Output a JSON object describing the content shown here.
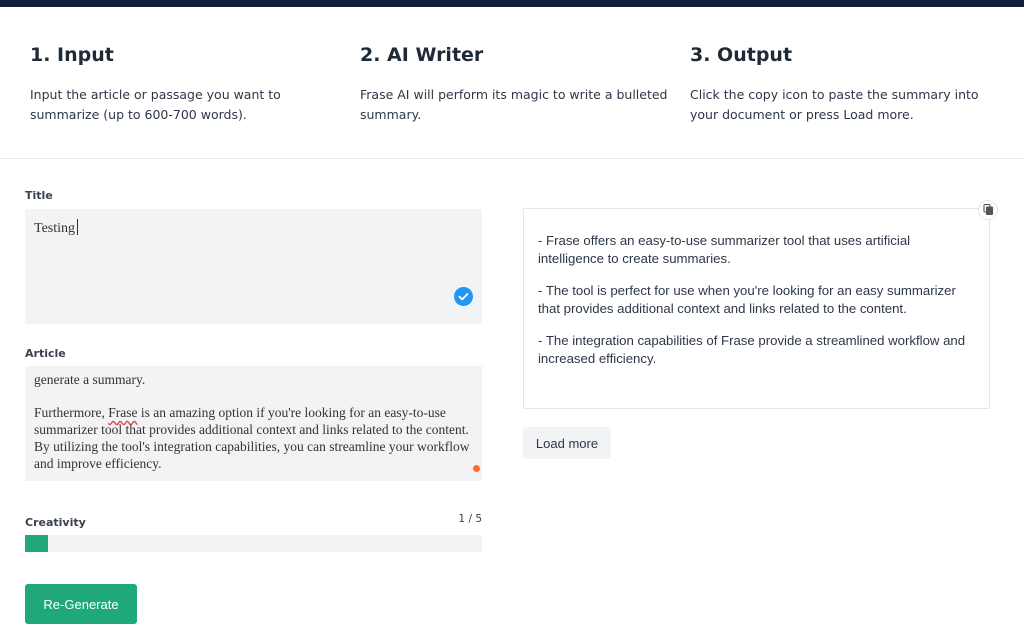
{
  "steps": [
    {
      "title": "1. Input",
      "description": "Input the article or passage you want to summarize (up to 600-700 words)."
    },
    {
      "title": "2. AI Writer",
      "description": "Frase AI will perform its magic to write a bulleted summary."
    },
    {
      "title": "3. Output",
      "description": "Click the copy icon to paste the summary into your document or press Load more."
    }
  ],
  "form": {
    "title_label": "Title",
    "title_value": "Testing",
    "article_label": "Article",
    "article_paragraphs": {
      "p1": "generate a summary.",
      "p2_before": "Furthermore, ",
      "p2_flagged_word": "Frase",
      "p2_after": " is an amazing option if you're looking for an easy-to-use summarizer tool that provides additional context and links related to the content. By utilizing the tool's integration capabilities, you can streamline your workflow and improve efficiency."
    },
    "creativity_label": "Creativity",
    "creativity_value": "1 / 5",
    "creativity_level": 1,
    "creativity_max": 5,
    "regenerate_label": "Re-Generate"
  },
  "output": {
    "items": [
      "- Frase offers an easy-to-use summarizer tool that uses artificial intelligence to create summaries.",
      "- The tool is perfect for use when you're looking for an easy summarizer that provides additional context and links related to the content.",
      "- The integration capabilities of Frase provide a streamlined workflow and increased efficiency."
    ],
    "load_more_label": "Load more"
  },
  "icons": {
    "check": "check-circle-icon",
    "copy": "copy-icon",
    "indicator": "orange-dot-indicator"
  },
  "colors": {
    "top_bar": "#0f1f3a",
    "accent_green": "#1fa97a",
    "check_blue": "#2196f3",
    "indicator_orange": "#ff6b2c",
    "field_bg": "#f1f3f5"
  }
}
